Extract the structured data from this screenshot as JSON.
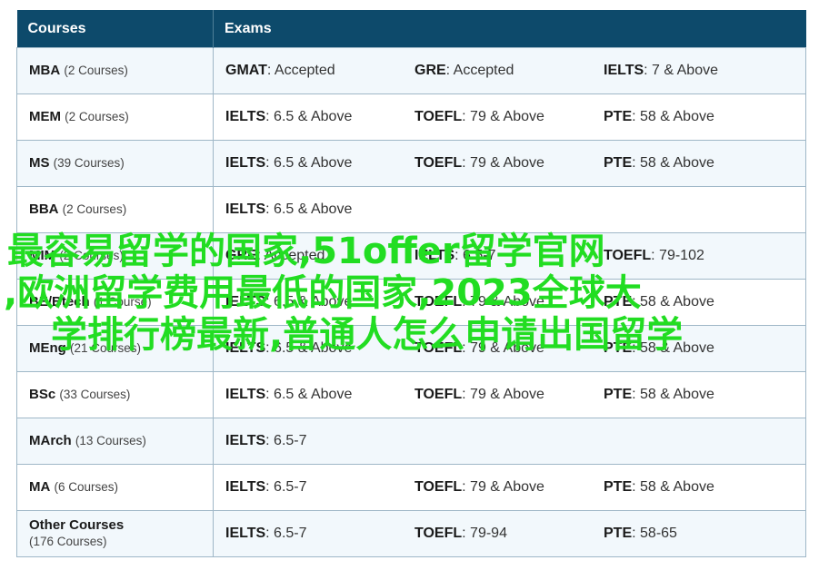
{
  "header": {
    "courses": "Courses",
    "exams": "Exams"
  },
  "rows": [
    {
      "name": "MBA",
      "count": "(2 Courses)",
      "exams": [
        {
          "test": "GMAT",
          "score": ": Accepted"
        },
        {
          "test": "GRE",
          "score": ": Accepted"
        },
        {
          "test": "IELTS",
          "score": ": 7 & Above"
        }
      ]
    },
    {
      "name": "MEM",
      "count": "(2 Courses)",
      "exams": [
        {
          "test": "IELTS",
          "score": ": 6.5 & Above"
        },
        {
          "test": "TOEFL",
          "score": ": 79 & Above"
        },
        {
          "test": "PTE",
          "score": ": 58 & Above"
        }
      ]
    },
    {
      "name": "MS",
      "count": "(39 Courses)",
      "exams": [
        {
          "test": "IELTS",
          "score": ": 6.5 & Above"
        },
        {
          "test": "TOEFL",
          "score": ": 79 & Above"
        },
        {
          "test": "PTE",
          "score": ": 58 & Above"
        }
      ]
    },
    {
      "name": "BBA",
      "count": "(2 Courses)",
      "exams": [
        {
          "test": "IELTS",
          "score": ": 6.5 & Above"
        }
      ]
    },
    {
      "name": "MIM",
      "count": "(2 Courses)",
      "exams": [
        {
          "test": "GRE",
          "score": ": Accepted"
        },
        {
          "test": "IELTS",
          "score": ": 6.5-7"
        },
        {
          "test": "TOEFL",
          "score": ": 79-102"
        }
      ]
    },
    {
      "name": "BE/Btech",
      "count": "(1 Course)",
      "exams": [
        {
          "test": "IELTS",
          "score": ": 6.5 & Above"
        },
        {
          "test": "TOEFL",
          "score": ": 79 & Above"
        },
        {
          "test": "PTE",
          "score": ": 58 & Above"
        }
      ]
    },
    {
      "name": "MEng",
      "count": "(21 Courses)",
      "exams": [
        {
          "test": "IELTS",
          "score": ": 6.5 & Above"
        },
        {
          "test": "TOEFL",
          "score": ": 79 & Above"
        },
        {
          "test": "PTE",
          "score": ": 58 & Above"
        }
      ]
    },
    {
      "name": "BSc",
      "count": "(33 Courses)",
      "exams": [
        {
          "test": "IELTS",
          "score": ": 6.5 & Above"
        },
        {
          "test": "TOEFL",
          "score": ": 79 & Above"
        },
        {
          "test": "PTE",
          "score": ": 58 & Above"
        }
      ]
    },
    {
      "name": "MArch",
      "count": "(13 Courses)",
      "exams": [
        {
          "test": "IELTS",
          "score": ": 6.5-7"
        }
      ]
    },
    {
      "name": "MA",
      "count": "(6 Courses)",
      "exams": [
        {
          "test": "IELTS",
          "score": ": 6.5-7"
        },
        {
          "test": "TOEFL",
          "score": ": 79 & Above"
        },
        {
          "test": "PTE",
          "score": ": 58 & Above"
        }
      ]
    },
    {
      "name": "Other Courses",
      "count": "(176 Courses)",
      "exams": [
        {
          "test": "IELTS",
          "score": ": 6.5-7"
        },
        {
          "test": "TOEFL",
          "score": ": 79-94"
        },
        {
          "test": "PTE",
          "score": ": 58-65"
        }
      ]
    }
  ],
  "watermark": {
    "line1": "最容易留学的国家,51offer留学官网",
    "line2": ",欧洲留学费用最低的国家,2023全球大",
    "line3": "学排行榜最新,普通人怎么申请出国留学",
    "color": "#22dd22"
  },
  "colors": {
    "header_bg": "#0d4a6b",
    "alt_row_bg": "#f2f8fc",
    "border": "#9fb7c7"
  }
}
